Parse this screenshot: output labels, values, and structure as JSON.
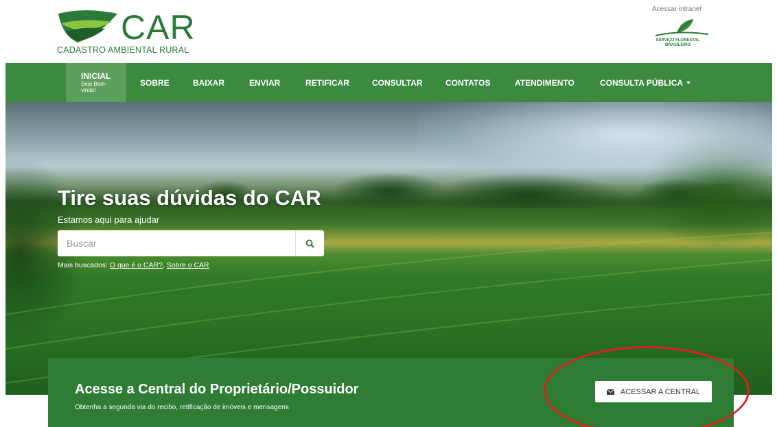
{
  "header": {
    "logo_text": "CAR",
    "logo_subtitle": "CADASTRO AMBIENTAL RURAL",
    "intranet_link": "Acessar intranet",
    "partner_logo_lines": [
      "SERVIÇO FLORESTAL",
      "BRASILEIRO"
    ]
  },
  "nav": {
    "active": {
      "label": "INICIAL",
      "sub": "Seja Bem-vindo!"
    },
    "items": [
      "SOBRE",
      "BAIXAR",
      "ENVIAR",
      "RETIFICAR",
      "CONSULTAR",
      "CONTATOS",
      "ATENDIMENTO",
      "CONSULTA PÚBLICA"
    ]
  },
  "hero": {
    "title": "Tire suas dúvidas do CAR",
    "subtitle": "Estamos aqui para ajudar",
    "search_placeholder": "Buscar",
    "popular_label": "Mais buscados:",
    "popular_links": [
      "O que é o CAR?",
      "Sobre o CAR"
    ]
  },
  "central": {
    "title": "Acesse a Central do Proprietário/Possuidor",
    "subtitle": "Obtenha a segunda via do recibo, retificação de imóveis e mensagens",
    "button_label": "ACESSAR A CENTRAL"
  },
  "colors": {
    "brand_green": "#3b8a3f",
    "active_nav": "#5c9e5c",
    "banner_green": "#2f7d34",
    "annotation_red": "#e0201c"
  }
}
